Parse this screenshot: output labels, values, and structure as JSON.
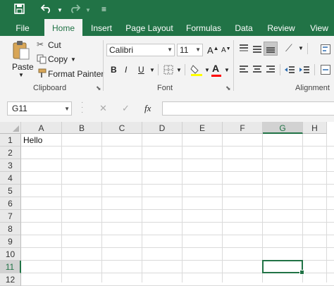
{
  "qat": {
    "save_icon": "save-icon",
    "undo_icon": "undo-icon",
    "redo_icon": "redo-icon",
    "customize_icon": "customize-icon"
  },
  "tabs": [
    "File",
    "Home",
    "Insert",
    "Page Layout",
    "Formulas",
    "Data",
    "Review",
    "View"
  ],
  "active_tab": "Home",
  "clipboard": {
    "paste": "Paste",
    "cut": "Cut",
    "copy": "Copy",
    "format_painter": "Format Painter",
    "label": "Clipboard"
  },
  "font": {
    "name": "Calibri",
    "size": "11",
    "label": "Font",
    "bold": "B",
    "italic": "I",
    "underline": "U",
    "grow": "A",
    "shrink": "A"
  },
  "alignment": {
    "label": "Alignment"
  },
  "formula_bar": {
    "name_box": "G11",
    "cancel": "✕",
    "enter": "✓",
    "fx": "fx",
    "value": ""
  },
  "columns": [
    "A",
    "B",
    "C",
    "D",
    "E",
    "F",
    "G",
    "H"
  ],
  "rows": [
    "1",
    "2",
    "3",
    "4",
    "5",
    "6",
    "7",
    "8",
    "9",
    "10",
    "11",
    "12"
  ],
  "cells": {
    "A1": "Hello"
  },
  "selected_cell": "G11",
  "colors": {
    "accent": "#217346",
    "font_color": "#ff0000",
    "highlight": "#ffff00"
  }
}
